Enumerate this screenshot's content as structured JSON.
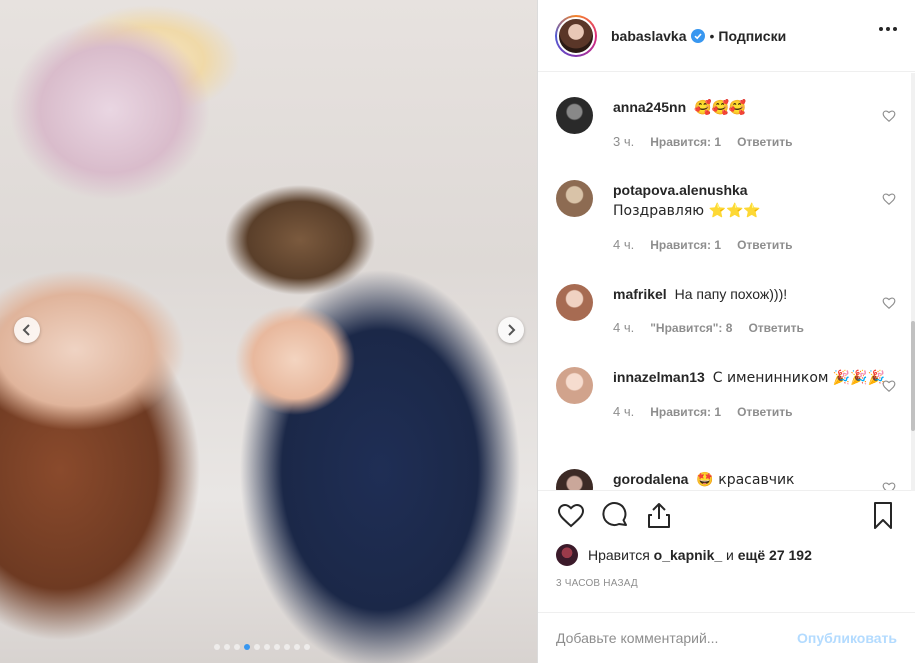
{
  "header": {
    "username": "babaslavka",
    "separator": "•",
    "follow_label": "Подписки"
  },
  "comments": [
    {
      "username": "anna245nn",
      "text": "🥰🥰🥰",
      "time": "3 ч.",
      "likes": "Нравится: 1",
      "reply": "Ответить",
      "avatar_color": "#3a3a3a"
    },
    {
      "username": "potapova.alenushka",
      "text": "Поздравляю ⭐️⭐️⭐️",
      "time": "4 ч.",
      "likes": "Нравится: 1",
      "reply": "Ответить",
      "avatar_color": "#b08a6a"
    },
    {
      "username": "mafrikel",
      "text": "На папу похож)))!",
      "time": "4 ч.",
      "likes": "\"Нравится\": 8",
      "reply": "Ответить",
      "avatar_color": "#c79580"
    },
    {
      "username": "innazelman13",
      "text": "С именинником 🎉🎉🎉",
      "time": "4 ч.",
      "likes": "Нравится: 1",
      "reply": "Ответить",
      "avatar_color": "#d6b0a0"
    },
    {
      "username": "gorodalena",
      "text": "🤩 красавчик",
      "avatar_color": "#3c2a25"
    }
  ],
  "likes_summary": {
    "prefix": "Нравится",
    "user": "o_kapnik_",
    "conjunction": "и",
    "rest": "ещё 27 192"
  },
  "time_ago": "3 ЧАСОВ НАЗАД",
  "add_comment": {
    "placeholder": "Добавьте комментарий...",
    "publish_label": "Опубликовать"
  },
  "carousel": {
    "current_index": 4,
    "count": 10
  },
  "colors": {
    "accent": "#3897f0",
    "text": "#262626",
    "muted": "#8e8e8e",
    "publish_disabled": "#b3dbff"
  }
}
